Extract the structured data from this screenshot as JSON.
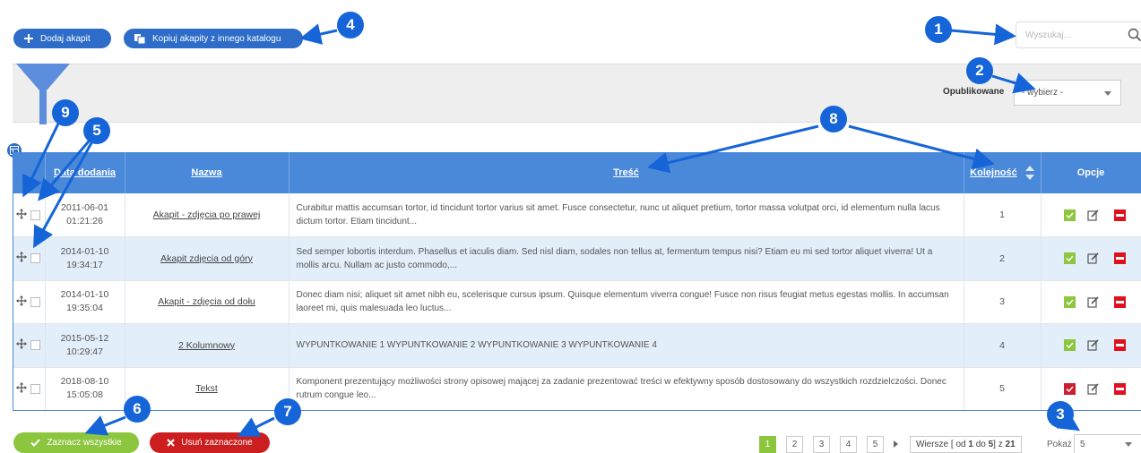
{
  "toolbar": {
    "add_label": "Dodaj akapit",
    "copy_label": "Kopiuj akapity z innego katalogu"
  },
  "search": {
    "placeholder": "Wyszukaj..."
  },
  "filter": {
    "published_label": "Opublikowane",
    "published_value": "- wybierz -"
  },
  "table": {
    "headers": {
      "date": "Data dodania",
      "name": "Nazwa",
      "content": "Treść",
      "order": "Kolejność",
      "options": "Opcje"
    },
    "rows": [
      {
        "date": "2011-06-01",
        "time": "01:21:26",
        "name": "Akapit - zdjęcia po prawej",
        "content": "Curabitur mattis accumsan tortor, id tincidunt tortor varius sit amet. Fusce consectetur, nunc ut aliquet pretium, tortor massa volutpat orci, id elementum nulla lacus dictum tortor. Etiam tincidunt...",
        "order": "1",
        "published": true
      },
      {
        "date": "2014-01-10",
        "time": "19:34:17",
        "name": "Akapit zdjęcia od góry",
        "content": "Sed semper lobortis interdum. Phasellus et iaculis diam. Sed nisl diam, sodales non tellus at, fermentum tempus nisi? Etiam eu mi sed tortor aliquet viverra! Ut a mollis arcu. Nullam ac justo commodo,...",
        "order": "2",
        "published": true
      },
      {
        "date": "2014-01-10",
        "time": "19:35:04",
        "name": "Akapit - zdjęcia od dołu",
        "content": "Donec diam nisi; aliquet sit amet nibh eu, scelerisque cursus ipsum. Quisque elementum viverra congue! Fusce non risus feugiat metus egestas mollis. In accumsan laoreet mi, quis malesuada leo luctus...",
        "order": "3",
        "published": true
      },
      {
        "date": "2015-05-12",
        "time": "10:29:47",
        "name": "2 Kolumnowy",
        "content": "WYPUNTKOWANIE 1 WYPUNTKOWANIE 2 WYPUNTKOWANIE 3 WYPUNTKOWANIE 4",
        "order": "4",
        "published": true
      },
      {
        "date": "2018-08-10",
        "time": "15:05:08",
        "name": "Tekst",
        "content": "Komponent prezentujący możliwości strony opisowej mającej za zadanie prezentować treści w efektywny sposób dostosowany do wszystkich rozdzielczości.   Donec rutrum congue leo...",
        "order": "5",
        "published": false
      }
    ]
  },
  "bulk": {
    "select_all_label": "Zaznacz wszystkie",
    "delete_selected_label": "Usuń zaznaczone"
  },
  "pagination": {
    "pages": [
      "1",
      "2",
      "3",
      "4",
      "5"
    ],
    "active_page": "1",
    "rows_prefix": "Wiersze [ od ",
    "rows_from": "1",
    "rows_mid": " do ",
    "rows_to": "5",
    "rows_suffix": "] z ",
    "rows_total": "21",
    "show_label": "Pokaż",
    "per_page": "5"
  },
  "callouts": [
    "1",
    "2",
    "3",
    "4",
    "5",
    "6",
    "7",
    "8",
    "9"
  ],
  "colors": {
    "primary": "#2d6cc8",
    "header": "#4a88d9",
    "callout": "#1565d8",
    "success": "#8cc63f",
    "danger": "#cc1e1e"
  }
}
